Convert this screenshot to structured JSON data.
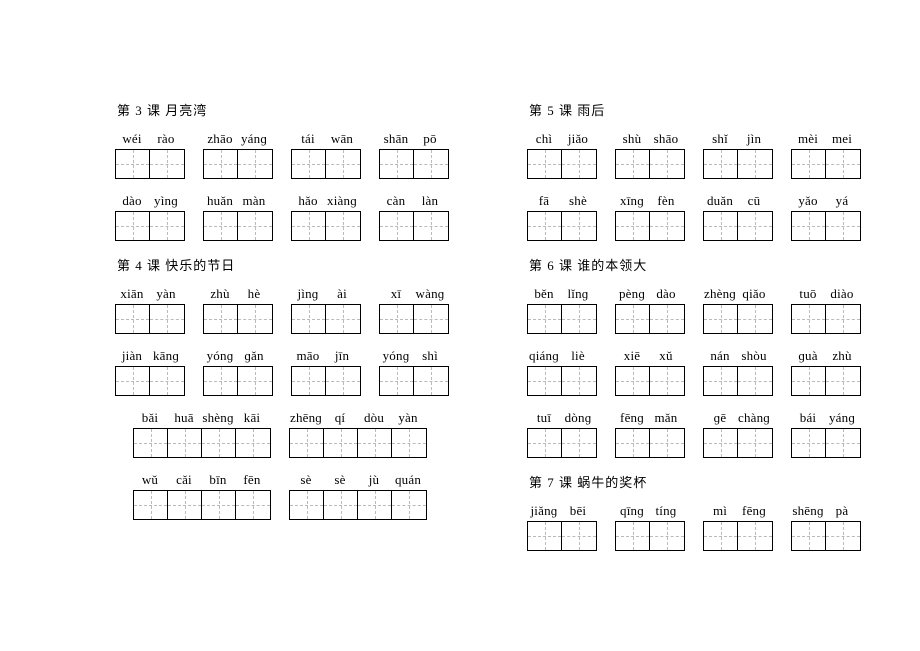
{
  "columns": [
    {
      "sections": [
        {
          "title": "第 3 课  月亮湾",
          "rows": [
            [
              {
                "pinyin": [
                  "wéi",
                  "rào"
                ],
                "cells": 2
              },
              {
                "pinyin": [
                  "zhāo",
                  "yánɡ"
                ],
                "cells": 2
              },
              {
                "pinyin": [
                  "tái",
                  "wān"
                ],
                "cells": 2
              },
              {
                "pinyin": [
                  "shān",
                  "pō"
                ],
                "cells": 2
              }
            ],
            [
              {
                "pinyin": [
                  "dào",
                  "yìnɡ"
                ],
                "cells": 2
              },
              {
                "pinyin": [
                  "huǎn",
                  "màn"
                ],
                "cells": 2
              },
              {
                "pinyin": [
                  "hǎo",
                  "xiànɡ"
                ],
                "cells": 2
              },
              {
                "pinyin": [
                  "càn",
                  "làn"
                ],
                "cells": 2
              }
            ]
          ]
        },
        {
          "title": "第 4 课  快乐的节日",
          "rows": [
            [
              {
                "pinyin": [
                  "xiān",
                  "yàn"
                ],
                "cells": 2
              },
              {
                "pinyin": [
                  "zhù",
                  "hè"
                ],
                "cells": 2
              },
              {
                "pinyin": [
                  "jìnɡ",
                  "ài"
                ],
                "cells": 2
              },
              {
                "pinyin": [
                  "xī",
                  "wànɡ"
                ],
                "cells": 2
              }
            ],
            [
              {
                "pinyin": [
                  "jiàn",
                  "kānɡ"
                ],
                "cells": 2
              },
              {
                "pinyin": [
                  "yónɡ",
                  "ɡǎn"
                ],
                "cells": 2
              },
              {
                "pinyin": [
                  "māo",
                  "jīn"
                ],
                "cells": 2
              },
              {
                "pinyin": [
                  "yónɡ",
                  "shì"
                ],
                "cells": 2
              }
            ],
            [
              {
                "pinyin": [
                  "bǎi",
                  "huā",
                  "shènɡ",
                  "kāi"
                ],
                "cells": 4,
                "indent": true
              },
              {
                "pinyin": [
                  "zhēnɡ",
                  "qí",
                  "dòu",
                  "yàn"
                ],
                "cells": 4
              }
            ],
            [
              {
                "pinyin": [
                  "wǔ",
                  "cǎi",
                  "bīn",
                  "fēn"
                ],
                "cells": 4,
                "indent": true
              },
              {
                "pinyin": [
                  "sè",
                  "sè",
                  "jù",
                  "quán"
                ],
                "cells": 4
              }
            ]
          ]
        }
      ]
    },
    {
      "sections": [
        {
          "title": "第 5 课  雨后",
          "rows": [
            [
              {
                "pinyin": [
                  "chì",
                  "jiǎo"
                ],
                "cells": 2
              },
              {
                "pinyin": [
                  "shù",
                  "shāo"
                ],
                "cells": 2
              },
              {
                "pinyin": [
                  "shǐ",
                  "jìn"
                ],
                "cells": 2
              },
              {
                "pinyin": [
                  "mèi",
                  "mei"
                ],
                "cells": 2
              }
            ],
            [
              {
                "pinyin": [
                  "fā",
                  "shè"
                ],
                "cells": 2
              },
              {
                "pinyin": [
                  "xīnɡ",
                  "fèn"
                ],
                "cells": 2
              },
              {
                "pinyin": [
                  "duǎn",
                  "cū"
                ],
                "cells": 2
              },
              {
                "pinyin": [
                  "yǎo",
                  "yá"
                ],
                "cells": 2
              }
            ]
          ]
        },
        {
          "title": "第 6 课  谁的本领大",
          "rows": [
            [
              {
                "pinyin": [
                  "běn",
                  "lǐnɡ"
                ],
                "cells": 2
              },
              {
                "pinyin": [
                  "pènɡ",
                  "dào"
                ],
                "cells": 2
              },
              {
                "pinyin": [
                  "zhènɡ",
                  "qiǎo"
                ],
                "cells": 2
              },
              {
                "pinyin": [
                  "tuō",
                  "diào"
                ],
                "cells": 2
              }
            ],
            [
              {
                "pinyin": [
                  "qiánɡ",
                  "liè"
                ],
                "cells": 2
              },
              {
                "pinyin": [
                  "xiē",
                  "xǔ"
                ],
                "cells": 2
              },
              {
                "pinyin": [
                  "nán",
                  "shòu"
                ],
                "cells": 2
              },
              {
                "pinyin": [
                  "ɡuà",
                  "zhù"
                ],
                "cells": 2
              }
            ],
            [
              {
                "pinyin": [
                  "tuī",
                  "dònɡ"
                ],
                "cells": 2
              },
              {
                "pinyin": [
                  "fēnɡ",
                  "mǎn"
                ],
                "cells": 2
              },
              {
                "pinyin": [
                  "ɡē",
                  "chànɡ"
                ],
                "cells": 2
              },
              {
                "pinyin": [
                  "bái",
                  "yánɡ"
                ],
                "cells": 2
              }
            ]
          ]
        },
        {
          "title": "第 7 课  蜗牛的奖杯",
          "rows": [
            [
              {
                "pinyin": [
                  "jiǎnɡ",
                  "bēi"
                ],
                "cells": 2
              },
              {
                "pinyin": [
                  "qīnɡ",
                  "tínɡ"
                ],
                "cells": 2
              },
              {
                "pinyin": [
                  "mì",
                  "fēnɡ"
                ],
                "cells": 2
              },
              {
                "pinyin": [
                  "shēnɡ",
                  "pà"
                ],
                "cells": 2
              }
            ]
          ]
        }
      ]
    }
  ],
  "cell_widths": {
    "2": 34,
    "4": 34
  }
}
